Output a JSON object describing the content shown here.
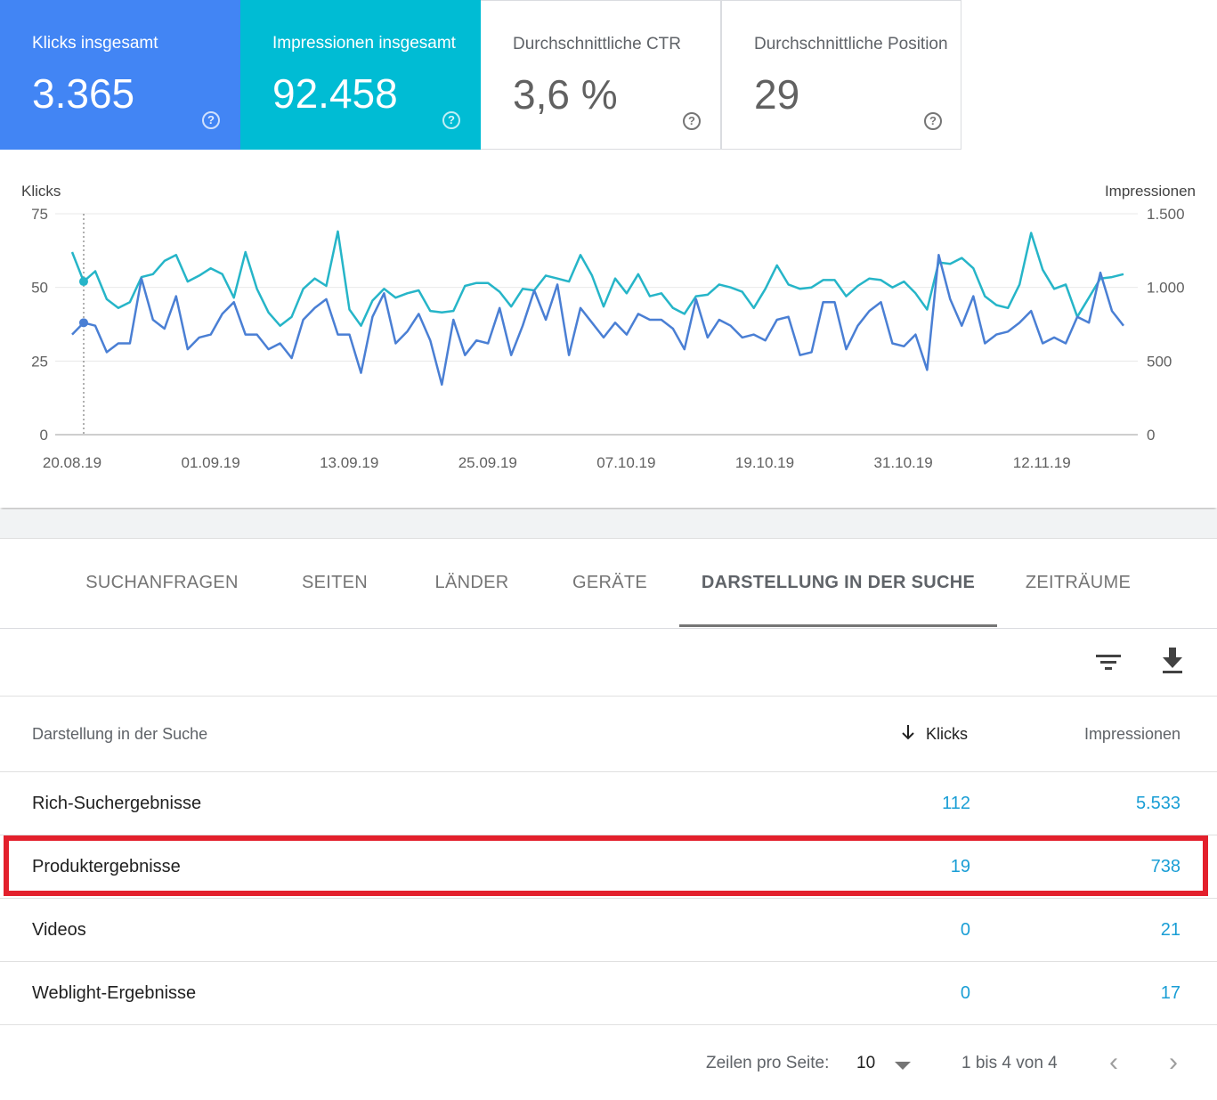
{
  "metrics": [
    {
      "label": "Klicks insgesamt",
      "value": "3.365"
    },
    {
      "label": "Impressionen insgesamt",
      "value": "92.458"
    },
    {
      "label": "Durchschnittliche CTR",
      "value": "3,6 %"
    },
    {
      "label": "Durchschnittliche Position",
      "value": "29"
    }
  ],
  "chart_data": {
    "type": "line",
    "y_left_label": "Klicks",
    "y_right_label": "Impressionen",
    "y_left_ticks": [
      "0",
      "25",
      "50",
      "75"
    ],
    "y_right_ticks": [
      "0",
      "500",
      "1.000",
      "1.500"
    ],
    "ylim_left": [
      0,
      75
    ],
    "ylim_right": [
      0,
      1500
    ],
    "x_tick_labels": [
      "20.08.19",
      "01.09.19",
      "13.09.19",
      "25.09.19",
      "07.10.19",
      "19.10.19",
      "31.10.19",
      "12.11.19"
    ],
    "x_start": "2019-08-19",
    "x_end": "2019-11-18",
    "grid": true,
    "series": [
      {
        "name": "Klicks",
        "axis": "left",
        "color": "#4a7fd4",
        "values": [
          34,
          38,
          37,
          28,
          31,
          31,
          53,
          39,
          36,
          47,
          29,
          33,
          34,
          41,
          45,
          34,
          34,
          29,
          31,
          26,
          39,
          43,
          46,
          34,
          34,
          21,
          40,
          48,
          31,
          35,
          41,
          32,
          17,
          39,
          27,
          32,
          31,
          43,
          27,
          37,
          49,
          39,
          51,
          27,
          43,
          38,
          33,
          38,
          34,
          41,
          39,
          39,
          36,
          29,
          46,
          33,
          39,
          37,
          33,
          34,
          32,
          39,
          40,
          27,
          28,
          45,
          45,
          29,
          37,
          42,
          45,
          31,
          30,
          34,
          22,
          61,
          46,
          37,
          47,
          31,
          34,
          35,
          38,
          42,
          31,
          33,
          31,
          40,
          38,
          55,
          42,
          37
        ]
      },
      {
        "name": "Impressionen",
        "axis": "right",
        "color": "#26b5c8",
        "values": [
          1240,
          1040,
          1110,
          920,
          860,
          900,
          1070,
          1090,
          1180,
          1220,
          1040,
          1080,
          1130,
          1090,
          930,
          1240,
          990,
          830,
          740,
          800,
          990,
          1060,
          1010,
          1380,
          850,
          740,
          910,
          990,
          930,
          960,
          980,
          840,
          830,
          840,
          1010,
          1030,
          1030,
          970,
          870,
          990,
          980,
          1080,
          1060,
          1040,
          1220,
          1080,
          870,
          1060,
          960,
          1090,
          940,
          960,
          860,
          820,
          940,
          950,
          1020,
          1000,
          970,
          860,
          990,
          1150,
          1020,
          990,
          1000,
          1050,
          1050,
          940,
          1010,
          1060,
          1050,
          1000,
          1040,
          960,
          850,
          1170,
          1160,
          1200,
          1130,
          940,
          880,
          860,
          1020,
          1370,
          1120,
          990,
          1020,
          800,
          930,
          1060,
          1070,
          1090
        ]
      }
    ]
  },
  "tabs": {
    "items": [
      "SUCHANFRAGEN",
      "SEITEN",
      "LÄNDER",
      "GERÄTE",
      "DARSTELLUNG IN DER SUCHE",
      "ZEITRÄUME"
    ],
    "active": "DARSTELLUNG IN DER SUCHE"
  },
  "toolbar": {
    "filter_icon": "filter-icon",
    "download_icon": "download-icon"
  },
  "table": {
    "headers": {
      "name": "Darstellung in der Suche",
      "clicks": "Klicks",
      "impressions": "Impressionen"
    },
    "sort_icon": "arrow-down-icon",
    "rows": [
      {
        "name": "Rich-Suchergebnisse",
        "clicks": "112",
        "impressions": "5.533"
      },
      {
        "name": "Produktergebnisse",
        "clicks": "19",
        "impressions": "738",
        "highlighted": true
      },
      {
        "name": "Videos",
        "clicks": "0",
        "impressions": "21"
      },
      {
        "name": "Weblight-Ergebnisse",
        "clicks": "0",
        "impressions": "17"
      }
    ],
    "highlight_color": "#e3202c"
  },
  "pagination": {
    "rows_label": "Zeilen pro Seite:",
    "rows_value": "10",
    "range": "1 bis 4 von 4",
    "prev_icon": "chevron-left-icon",
    "next_icon": "chevron-right-icon"
  }
}
